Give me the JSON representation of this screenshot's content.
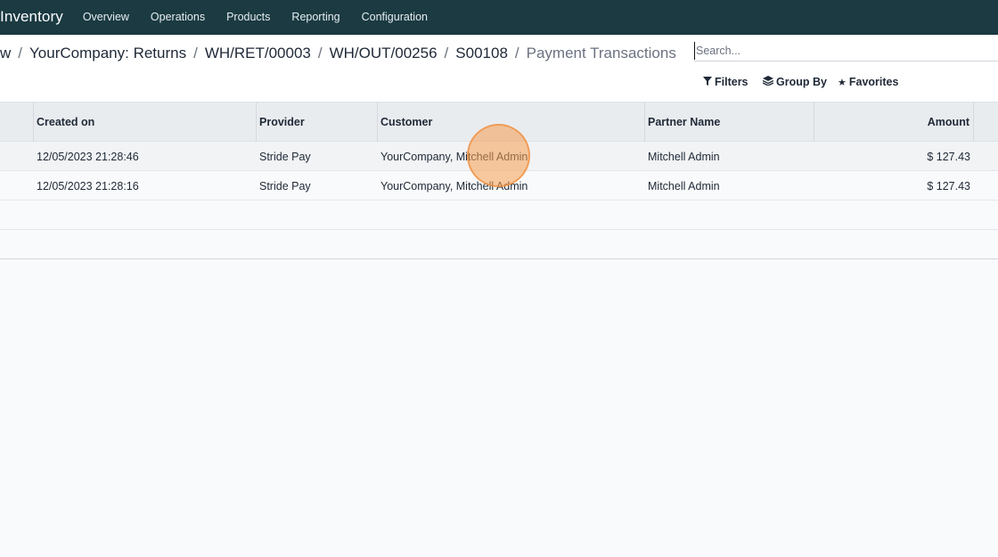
{
  "navbar": {
    "app_name": "Inventory",
    "menu": [
      "Overview",
      "Operations",
      "Products",
      "Reporting",
      "Configuration"
    ]
  },
  "breadcrumb": {
    "items": [
      "w",
      "YourCompany: Returns",
      "WH/RET/00003",
      "WH/OUT/00256",
      "S00108"
    ],
    "current": "Payment Transactions",
    "separator": "/"
  },
  "search": {
    "placeholder": "Search..."
  },
  "filters": {
    "filters_label": "Filters",
    "group_by_label": "Group By",
    "favorites_label": "Favorites"
  },
  "table": {
    "headers": [
      "Created on",
      "Provider",
      "Customer",
      "Partner Name",
      "Amount"
    ],
    "rows": [
      [
        "12/05/2023 21:28:46",
        "Stride Pay",
        "YourCompany, Mitchell Admin",
        "Mitchell Admin",
        "$ 127.43"
      ],
      [
        "12/05/2023 21:28:16",
        "Stride Pay",
        "YourCompany, Mitchell Admin",
        "Mitchell Admin",
        "$ 127.43"
      ]
    ]
  },
  "colors": {
    "navbar_bg": "#1b3a42",
    "header_bg": "#e9ecef",
    "click_marker": "#f59e50"
  }
}
